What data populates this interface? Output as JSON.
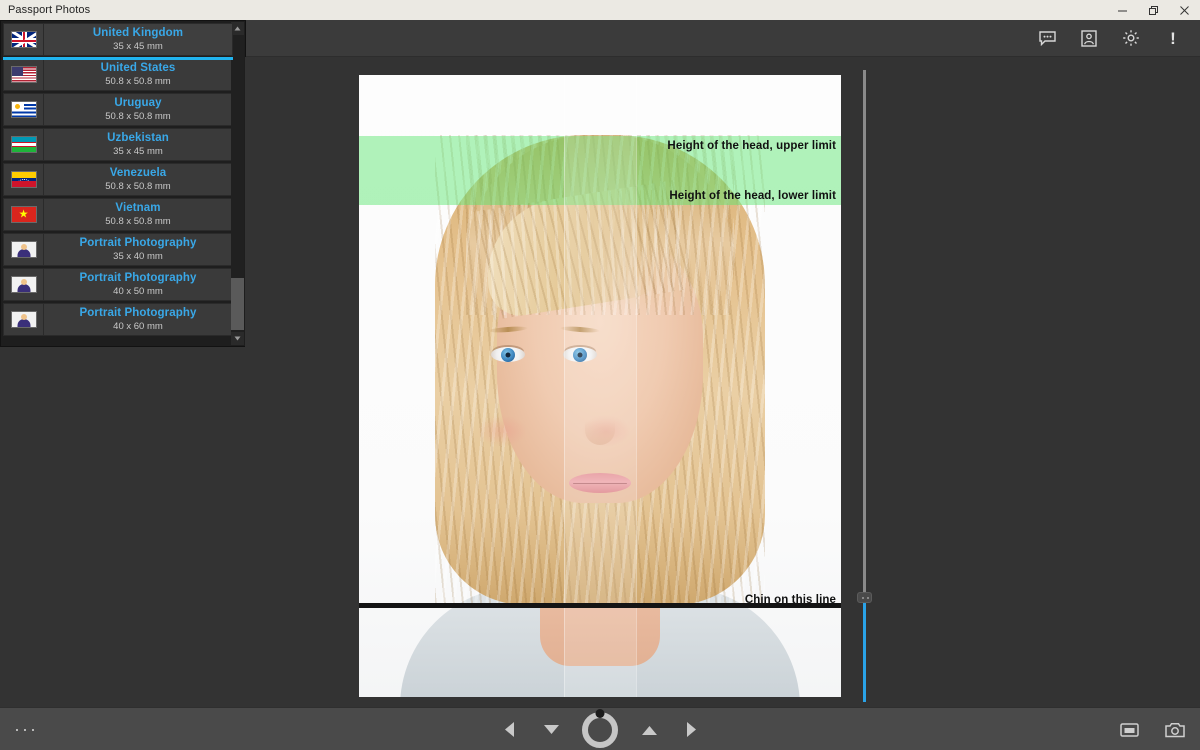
{
  "window": {
    "title": "Passport Photos",
    "controls": [
      {
        "name": "minimize",
        "label": "Minimize"
      },
      {
        "name": "restore",
        "label": "Restore"
      },
      {
        "name": "close",
        "label": "Close"
      }
    ]
  },
  "toolbar": {
    "icons": [
      {
        "name": "comment-icon",
        "label": "Comments"
      },
      {
        "name": "passport-frame-icon",
        "label": "Photo Frame"
      },
      {
        "name": "gear-icon",
        "label": "Settings"
      },
      {
        "name": "info-icon",
        "label": "!"
      }
    ]
  },
  "format_list": {
    "selected_index": 0,
    "items": [
      {
        "name": "United Kingdom",
        "size": "35 x 45 mm",
        "flag": "f-uk",
        "type": "country"
      },
      {
        "name": "United States",
        "size": "50.8 x 50.8 mm",
        "flag": "f-us",
        "type": "country"
      },
      {
        "name": "Uruguay",
        "size": "50.8 x 50.8 mm",
        "flag": "f-uy",
        "type": "country"
      },
      {
        "name": "Uzbekistan",
        "size": "35 x 45 mm",
        "flag": "f-uz",
        "type": "country"
      },
      {
        "name": "Venezuela",
        "size": "50.8 x 50.8 mm",
        "flag": "f-ve",
        "type": "country"
      },
      {
        "name": "Vietnam",
        "size": "50.8 x 50.8 mm",
        "flag": "f-vn",
        "type": "country"
      },
      {
        "name": "Portrait Photography",
        "size": "35 x 40 mm",
        "flag": "f-pp",
        "type": "portrait"
      },
      {
        "name": "Portrait Photography",
        "size": "40 x 50 mm",
        "flag": "f-pp",
        "type": "portrait"
      },
      {
        "name": "Portrait Photography",
        "size": "40 x 60 mm",
        "flag": "f-pp",
        "type": "portrait"
      }
    ]
  },
  "photo_guides": {
    "head_upper_limit": "Height of the head, upper limit",
    "head_lower_limit": "Height of the head, lower limit",
    "chin_line": "Chin on this line",
    "green_band_color": "#5ae66e",
    "chin_line_color": "#141414"
  },
  "crop_slider": {
    "name": "vertical-crop-slider",
    "filled_color": "#2aa3e8",
    "track_color": "#8a8a8a"
  },
  "bottom_bar": {
    "overflow_menu": "···",
    "controls": [
      {
        "name": "previous-photo-button",
        "label": "Previous"
      },
      {
        "name": "rotate-down-button",
        "label": "Rotate Down"
      },
      {
        "name": "rotation-dial",
        "label": "Rotation"
      },
      {
        "name": "rotate-up-button",
        "label": "Rotate Up"
      },
      {
        "name": "next-photo-button",
        "label": "Next"
      }
    ],
    "right_icons": [
      {
        "name": "save-icon",
        "label": "Save"
      },
      {
        "name": "camera-icon",
        "label": "Camera"
      }
    ]
  },
  "colors": {
    "accent": "#21b4ef",
    "link": "#39a8e8",
    "canvas_bg": "#333333",
    "panel_bg": "#1e1e1e",
    "titlebar_bg": "#ebe9e3"
  }
}
